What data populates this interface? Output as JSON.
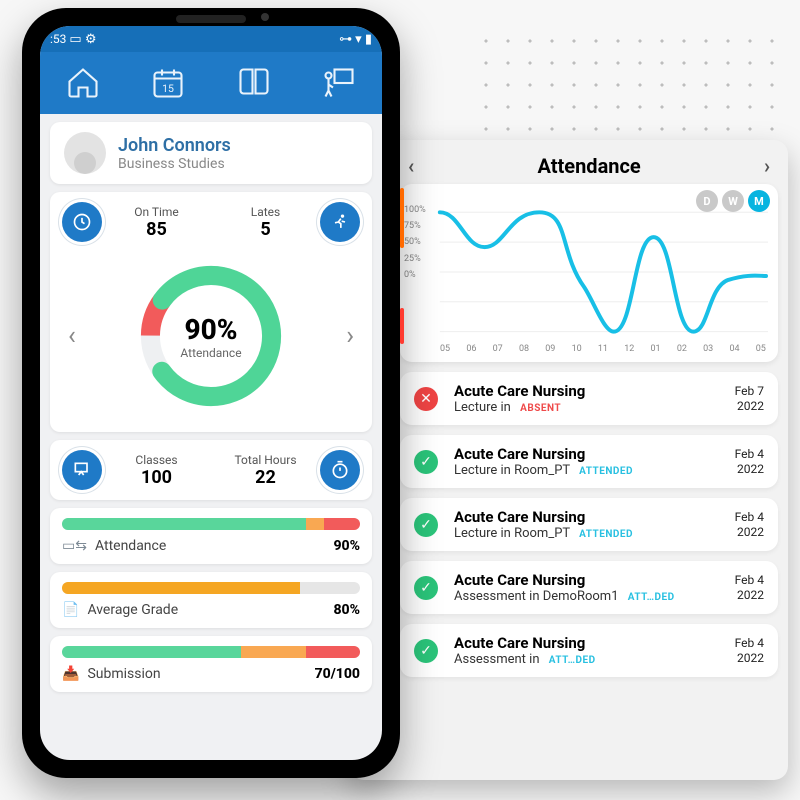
{
  "statusbar": {
    "time": ":53"
  },
  "profile": {
    "name": "John Connors",
    "course": "Business Studies"
  },
  "stats": {
    "ontime": {
      "label": "On Time",
      "value": "85"
    },
    "lates": {
      "label": "Lates",
      "value": "5"
    },
    "classes": {
      "label": "Classes",
      "value": "100"
    },
    "hours": {
      "label": "Total Hours",
      "value": "22"
    }
  },
  "attendanceDonut": {
    "percent": "90%",
    "label": "Attendance",
    "value": 90
  },
  "bars": {
    "attendance": {
      "label": "Attendance",
      "value": "90%",
      "pct": 90,
      "color1": "#59d69b",
      "color2": "#f9a852",
      "color2pct": 4,
      "color3": "#f25b5b",
      "color3pct": 6
    },
    "grade": {
      "label": "Average Grade",
      "value": "80%",
      "pct": 80,
      "color1": "#f5a623"
    },
    "submission": {
      "label": "Submission",
      "value": "70/100",
      "pct": 70,
      "color1": "#59d69b",
      "color2": "#f9a852",
      "color2pct": 18,
      "color3": "#f25b5b",
      "color3pct": 12
    }
  },
  "panel": {
    "title": "Attendance",
    "periods": {
      "d": "D",
      "w": "W",
      "m": "M",
      "active": "M"
    },
    "yticks": [
      "100%",
      "75%",
      "50%",
      "25%",
      "0%"
    ],
    "xticks": [
      "05",
      "06",
      "07",
      "08",
      "09",
      "10",
      "11",
      "12",
      "01",
      "02",
      "03",
      "04",
      "05"
    ]
  },
  "records": [
    {
      "title": "Acute Care Nursing",
      "sub": "Lecture in",
      "status": "ABSENT",
      "statusClass": "absent",
      "date1": "Feb 7",
      "date2": "2022",
      "ok": false
    },
    {
      "title": "Acute Care Nursing",
      "sub": "Lecture in Room_PT",
      "status": "ATTENDED",
      "statusClass": "attended",
      "date1": "Feb 4",
      "date2": "2022",
      "ok": true
    },
    {
      "title": "Acute Care Nursing",
      "sub": "Lecture in Room_PT",
      "status": "ATTENDED",
      "statusClass": "attended",
      "date1": "Feb 4",
      "date2": "2022",
      "ok": true
    },
    {
      "title": "Acute Care Nursing",
      "sub": "Assessment in DemoRoom1",
      "status": "ATT…DED",
      "statusClass": "attended",
      "date1": "Feb 4",
      "date2": "2022",
      "ok": true
    },
    {
      "title": "Acute Care Nursing",
      "sub": "Assessment in",
      "status": "ATT…DED",
      "statusClass": "attended",
      "date1": "Feb 4",
      "date2": "2022",
      "ok": true
    }
  ],
  "chart_data": {
    "type": "line",
    "title": "Attendance",
    "xlabel": "",
    "ylabel": "",
    "ylim": [
      0,
      100
    ],
    "x": [
      "05",
      "06",
      "07",
      "08",
      "09",
      "10",
      "11",
      "12",
      "01",
      "02",
      "03"
    ],
    "values": [
      100,
      72,
      90,
      100,
      70,
      0,
      82,
      0,
      40,
      48,
      47
    ]
  }
}
